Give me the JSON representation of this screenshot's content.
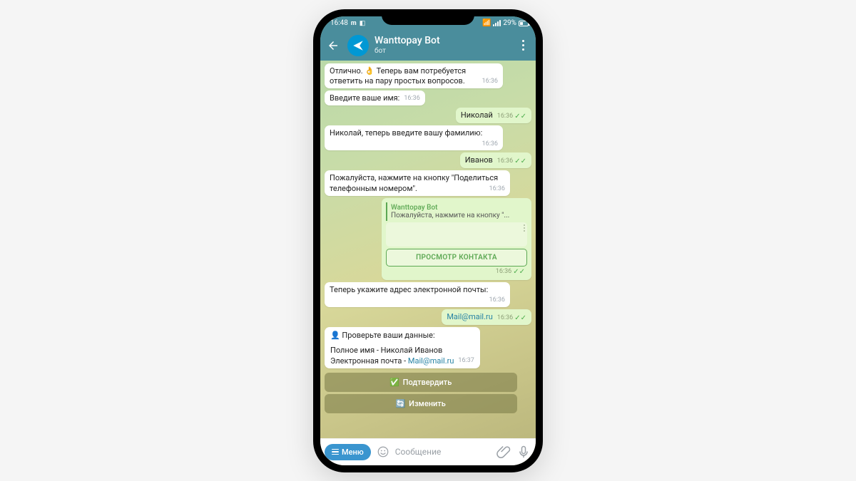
{
  "statusbar": {
    "time": "16:48",
    "battery": "29%"
  },
  "header": {
    "name": "Wanttopay Bot",
    "subtitle": "бот"
  },
  "messages": {
    "m1": {
      "text": "Отлично. 👌 Теперь вам потребуется ответить на пару простых вопросов.",
      "time": "16:36"
    },
    "m2": {
      "text": "Введите ваше имя:",
      "time": "16:36"
    },
    "m3": {
      "text": "Николай",
      "time": "16:36"
    },
    "m4": {
      "text": "Николай, теперь введите вашу фамилию:",
      "time": "16:36"
    },
    "m5": {
      "text": "Иванов",
      "time": "16:36"
    },
    "m6": {
      "text": "Пожалуйста, нажмите на кнопку \"Поделиться телефонным номером\".",
      "time": "16:36"
    },
    "contact": {
      "reply_name": "Wanttopay Bot",
      "reply_text": "Пожалуйста, нажмите на кнопку \"...",
      "button": "ПРОСМОТР КОНТАКТА",
      "time": "16:36"
    },
    "m7": {
      "text": "Теперь укажите адрес электронной почты:",
      "time": "16:36"
    },
    "m8": {
      "text": "Mail@mail.ru",
      "time": "16:36"
    },
    "verify": {
      "line1": "👤 Проверьте ваши данные:",
      "line2": "Полное имя - Николай Иванов",
      "line3_prefix": "Электронная почта - ",
      "line3_link": "Mail@mail.ru",
      "time": "16:37"
    },
    "buttons": {
      "confirm": "Подтвердить",
      "edit": "Изменить"
    }
  },
  "input": {
    "menu": "Меню",
    "placeholder": "Сообщение"
  }
}
